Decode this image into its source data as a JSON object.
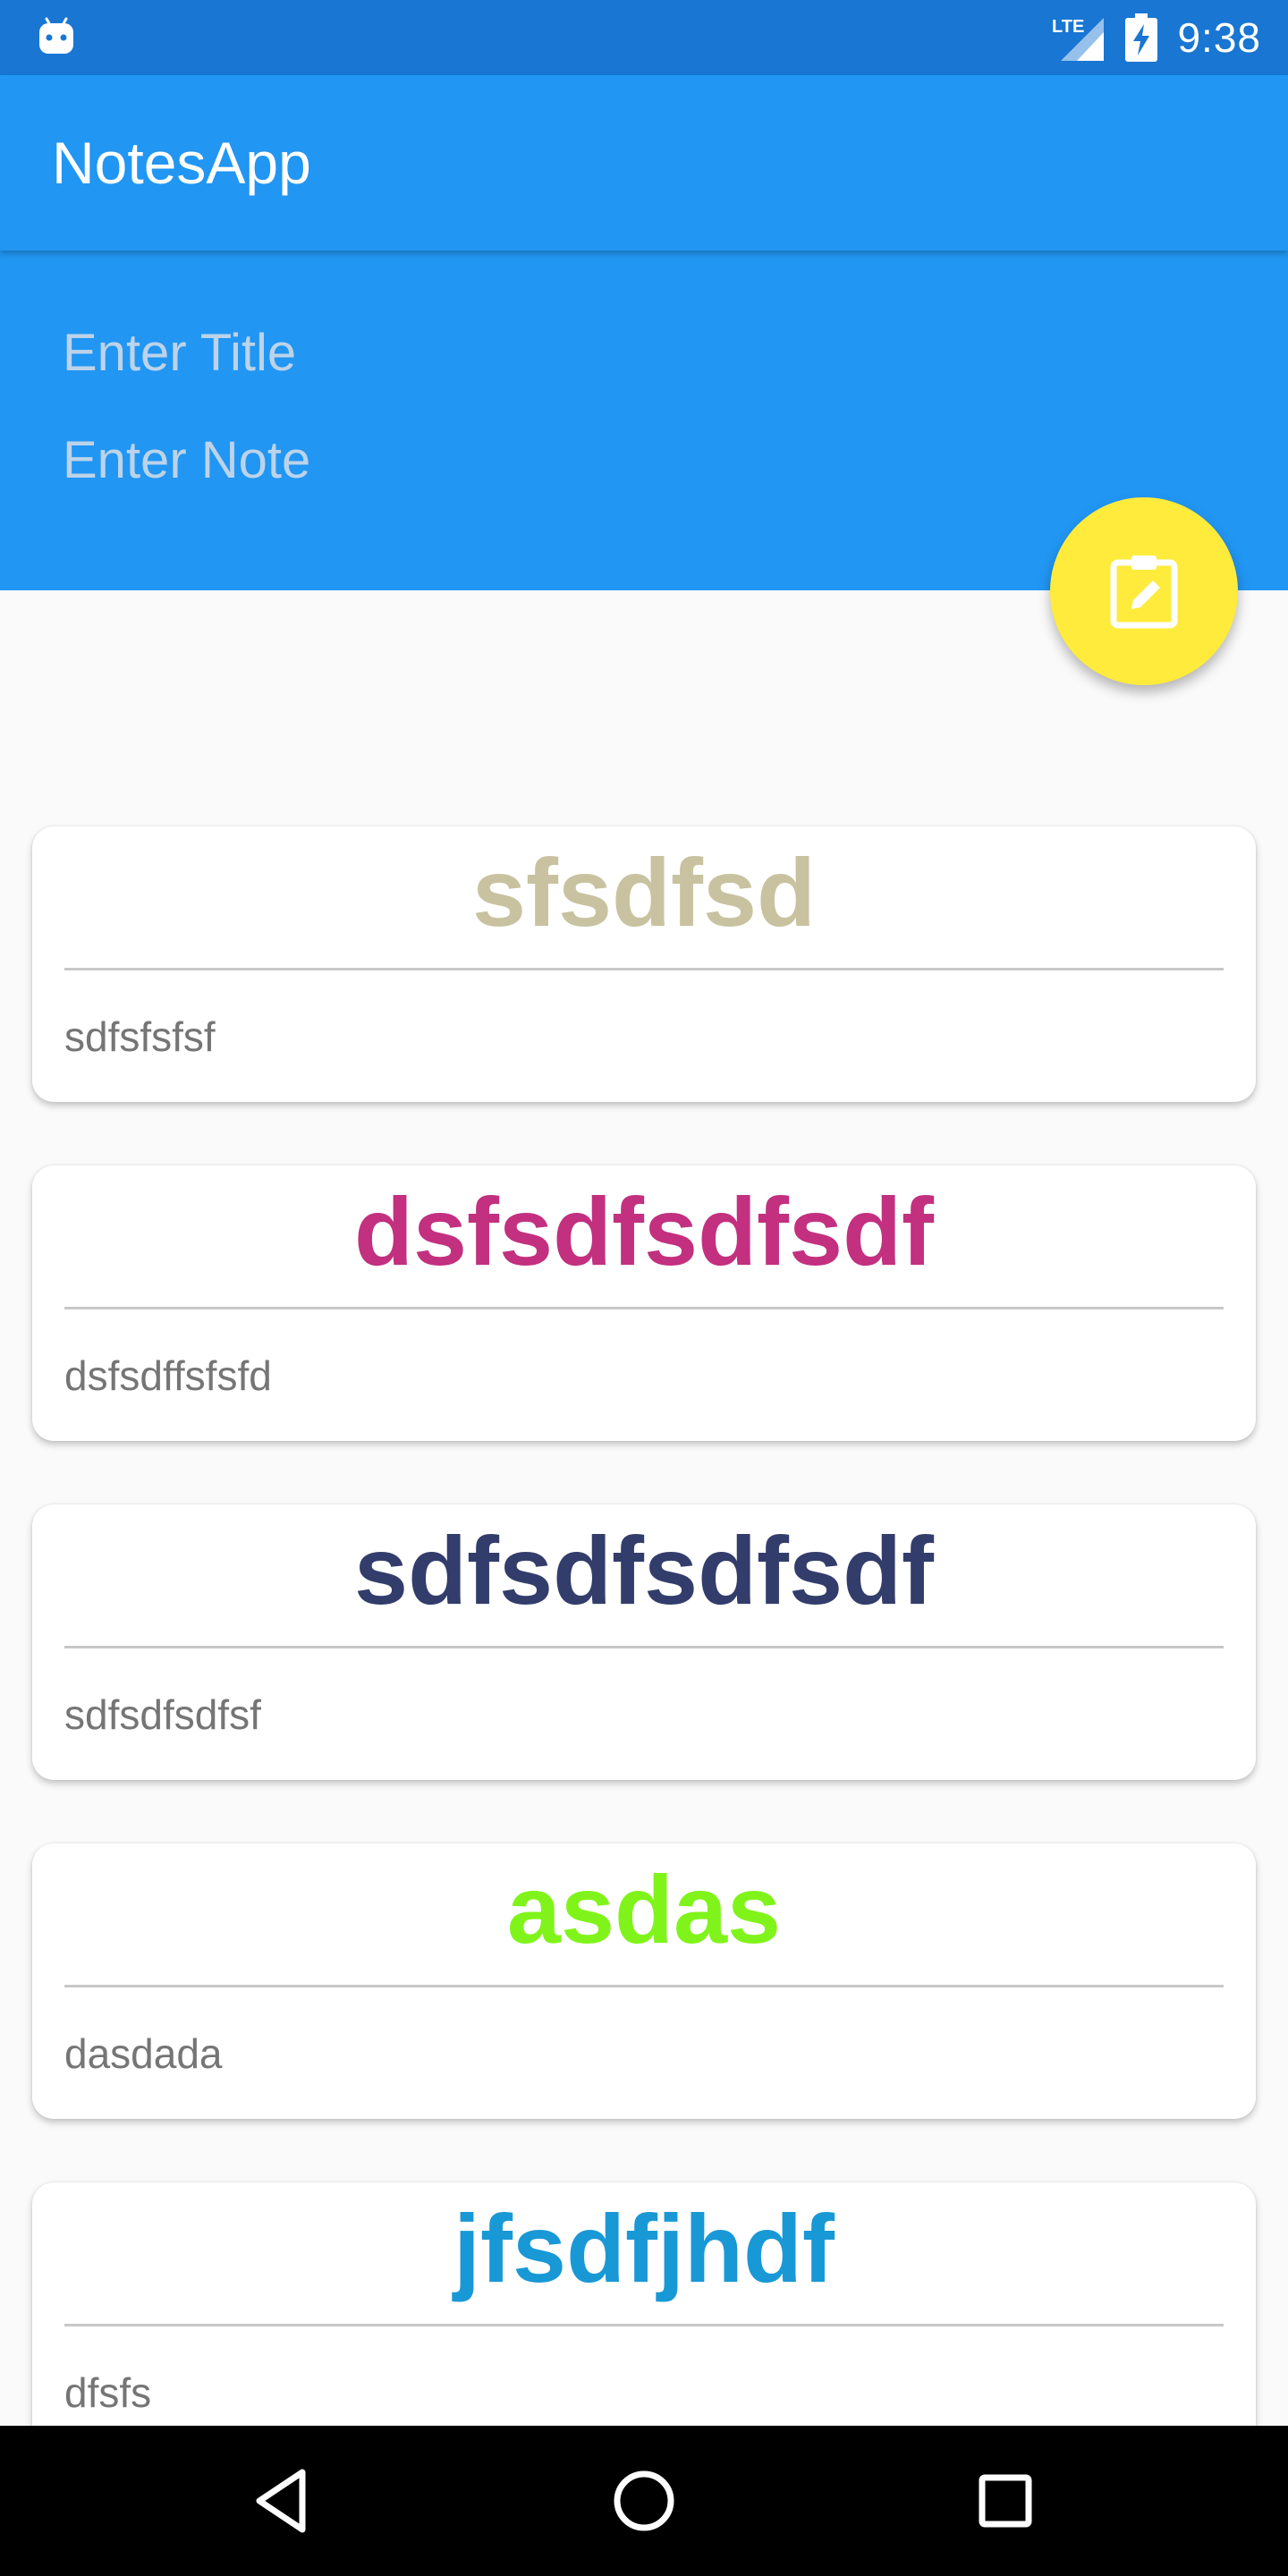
{
  "status_bar": {
    "time": "9:38",
    "network_label": "LTE",
    "icons": [
      "android-icon",
      "lte-signal-icon",
      "battery-charging-icon"
    ]
  },
  "app_bar": {
    "title": "NotesApp"
  },
  "input_panel": {
    "title_placeholder": "Enter Title",
    "note_placeholder": "Enter Note"
  },
  "fab": {
    "icon": "clipboard-edit-icon",
    "color": "#ffeb3b"
  },
  "notes": [
    {
      "title": "sfsdfsd",
      "body": "sdfsfsfsf",
      "color": "#c8c2a0"
    },
    {
      "title": "dsfsdfsdfsdf",
      "body": "dsfsdffsfsfd",
      "color": "#c2307f"
    },
    {
      "title": "sdfsdfsdfsdf",
      "body": "sdfsdfsdfsf",
      "color": "#333d6b"
    },
    {
      "title": "asdas",
      "body": "dasdada",
      "color": "#80f41a"
    },
    {
      "title": "jfsdfjhdf",
      "body": "dfsfs",
      "color": "#1998d6"
    }
  ],
  "nav_bar": {
    "icons": [
      "back-icon",
      "home-icon",
      "recents-icon"
    ]
  },
  "colors": {
    "status_bar": "#1976d2",
    "primary": "#2196f3",
    "background": "#fafafa",
    "placeholder": "#bcd3ea"
  }
}
